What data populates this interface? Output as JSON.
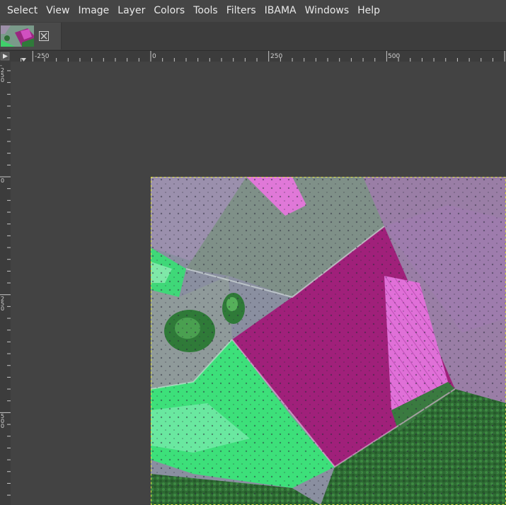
{
  "menubar": {
    "items": [
      "Select",
      "View",
      "Image",
      "Layer",
      "Colors",
      "Tools",
      "Filters",
      "IBAMA",
      "Windows",
      "Help"
    ]
  },
  "tab": {
    "thumbnail_icon": "image-thumbnail",
    "close_icon": "close-icon"
  },
  "rulers": {
    "horizontal_labels": [
      "-250",
      "0",
      "250",
      "500"
    ],
    "vertical_labels": [
      "-250",
      "0",
      "250",
      "500"
    ]
  },
  "colors": {
    "background": "#454545",
    "canvas": "#434343",
    "ruler": "#3c3c3c",
    "magenta": "#a0207a",
    "green": "#2f8a3a"
  }
}
